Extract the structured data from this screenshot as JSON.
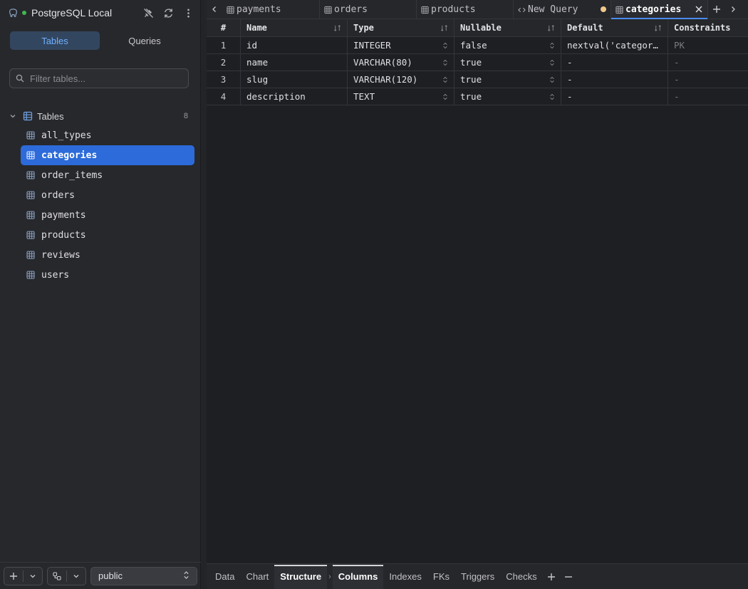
{
  "connection": {
    "name": "PostgreSQL Local",
    "status_color": "#3fb950",
    "db_icon": "elephant-icon"
  },
  "sidebar": {
    "tabs": [
      {
        "label": "Tables",
        "active": true
      },
      {
        "label": "Queries",
        "active": false
      }
    ],
    "filter_placeholder": "Filter tables...",
    "group": {
      "label": "Tables",
      "count": "8"
    },
    "tables": [
      {
        "name": "all_types",
        "selected": false
      },
      {
        "name": "categories",
        "selected": true
      },
      {
        "name": "order_items",
        "selected": false
      },
      {
        "name": "orders",
        "selected": false
      },
      {
        "name": "payments",
        "selected": false
      },
      {
        "name": "products",
        "selected": false
      },
      {
        "name": "reviews",
        "selected": false
      },
      {
        "name": "users",
        "selected": false
      }
    ],
    "schema": "public"
  },
  "tabs": [
    {
      "label": "payments",
      "icon": "table-icon"
    },
    {
      "label": "orders",
      "icon": "table-icon"
    },
    {
      "label": "products",
      "icon": "table-icon"
    },
    {
      "label": "New Query",
      "icon": "code-icon",
      "dirty": true
    },
    {
      "label": "categories",
      "icon": "table-icon",
      "active": true
    }
  ],
  "grid": {
    "columns": [
      "#",
      "Name",
      "Type",
      "Nullable",
      "Default",
      "Constraints"
    ],
    "rows": [
      {
        "num": "1",
        "name": "id",
        "type": "INTEGER",
        "nullable": "false",
        "default": "nextval('categori…",
        "constraints": "PK"
      },
      {
        "num": "2",
        "name": "name",
        "type": "VARCHAR(80)",
        "nullable": "true",
        "default": "-",
        "constraints": "-"
      },
      {
        "num": "3",
        "name": "slug",
        "type": "VARCHAR(120)",
        "nullable": "true",
        "default": "-",
        "constraints": "-"
      },
      {
        "num": "4",
        "name": "description",
        "type": "TEXT",
        "nullable": "true",
        "default": "-",
        "constraints": "-"
      }
    ]
  },
  "bottom_tabs": {
    "left": [
      {
        "label": "Data"
      },
      {
        "label": "Chart"
      },
      {
        "label": "Structure",
        "active": true
      }
    ],
    "right": [
      {
        "label": "Columns",
        "active": true
      },
      {
        "label": "Indexes"
      },
      {
        "label": "FKs"
      },
      {
        "label": "Triggers"
      },
      {
        "label": "Checks"
      }
    ]
  }
}
